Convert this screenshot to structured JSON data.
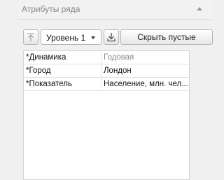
{
  "panel": {
    "title": "Атрибуты ряда"
  },
  "toolbar": {
    "level_select": {
      "selected": "Уровень 1"
    },
    "hide_empty_label": "Скрыть пустые"
  },
  "attributes": [
    {
      "name": "*Динамика",
      "value": "Годовая",
      "muted": true
    },
    {
      "name": "*Город",
      "value": "Лондон",
      "muted": false
    },
    {
      "name": "*Показатель",
      "value": "Население, млн. чел...",
      "muted": false
    }
  ]
}
